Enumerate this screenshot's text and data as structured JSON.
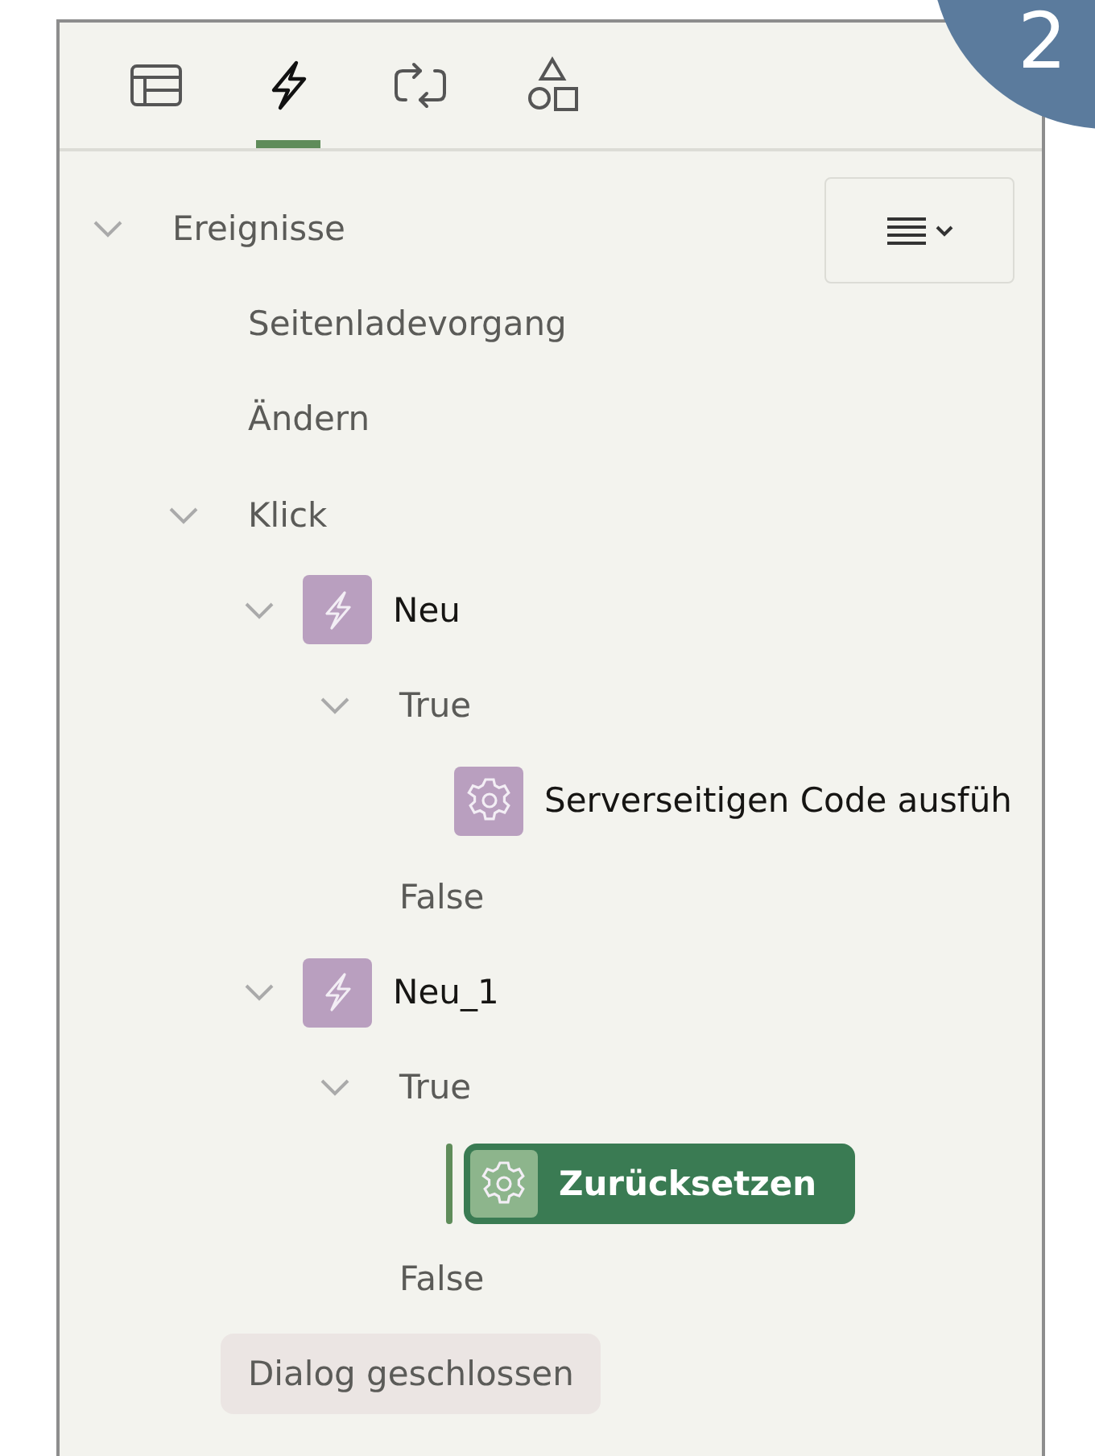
{
  "tabs": [
    {
      "kind": "layout",
      "selected": false
    },
    {
      "kind": "events",
      "selected": true
    },
    {
      "kind": "processing",
      "selected": false
    },
    {
      "kind": "shared",
      "selected": false
    }
  ],
  "badge": "2",
  "tree": [
    {
      "label": "Ereignisse",
      "kind": "folder",
      "expanded": true,
      "selected": false,
      "hovered": false,
      "children": [
        {
          "label": "Seitenladevorgang",
          "kind": "folder",
          "selected": false,
          "hovered": false
        },
        {
          "label": "Ändern",
          "kind": "folder",
          "selected": false,
          "hovered": false
        },
        {
          "label": "Klick",
          "kind": "folder",
          "expanded": true,
          "selected": false,
          "hovered": false,
          "children": [
            {
              "label": "Neu",
              "kind": "dynamic_action",
              "expanded": true,
              "selected": false,
              "hovered": false,
              "children": [
                {
                  "label": "True",
                  "kind": "folder",
                  "expanded": true,
                  "selected": false,
                  "hovered": false,
                  "children": [
                    {
                      "label": "Serverseitigen Code ausfüh",
                      "kind": "action",
                      "selected": false,
                      "hovered": false
                    }
                  ]
                },
                {
                  "label": "False",
                  "kind": "folder",
                  "selected": false,
                  "hovered": false
                }
              ]
            },
            {
              "label": "Neu_1",
              "kind": "dynamic_action",
              "expanded": true,
              "selected": false,
              "hovered": false,
              "children": [
                {
                  "label": "True",
                  "kind": "folder",
                  "expanded": true,
                  "selected": false,
                  "hovered": false,
                  "children": [
                    {
                      "label": "Zurücksetzen",
                      "kind": "action",
                      "selected": true,
                      "hovered": false
                    }
                  ]
                },
                {
                  "label": "False",
                  "kind": "folder",
                  "selected": false,
                  "hovered": false
                }
              ]
            }
          ]
        },
        {
          "label": "Dialog geschlossen",
          "kind": "folder",
          "selected": false,
          "hovered": true
        }
      ]
    }
  ]
}
